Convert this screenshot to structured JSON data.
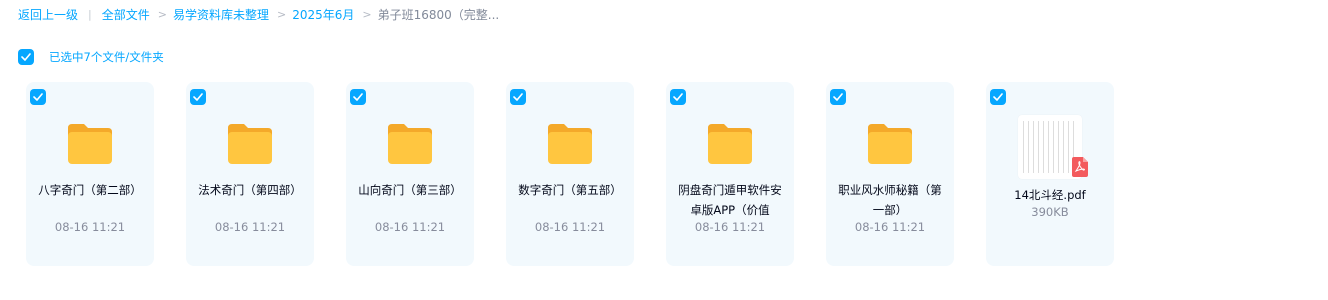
{
  "breadcrumb": {
    "back": "返回上一级",
    "divider": "|",
    "items": [
      "全部文件",
      "易学资料库未整理",
      "2025年6月"
    ],
    "sep": ">",
    "current": "弟子班16800（完整..."
  },
  "selection": {
    "text": "已选中7个文件/文件夹"
  },
  "items": [
    {
      "name": "八字奇门（第二部）",
      "meta": "08-16 11:21",
      "type": "folder"
    },
    {
      "name": "法术奇门（第四部）",
      "meta": "08-16 11:21",
      "type": "folder"
    },
    {
      "name": "山向奇门（第三部）",
      "meta": "08-16 11:21",
      "type": "folder"
    },
    {
      "name": "数字奇门（第五部）",
      "meta": "08-16 11:21",
      "type": "folder"
    },
    {
      "name": "阴盘奇门遁甲软件安卓版APP（价值",
      "meta": "08-16 11:21",
      "type": "folder"
    },
    {
      "name": "职业风水师秘籍（第一部）",
      "meta": "08-16 11:21",
      "type": "folder"
    },
    {
      "name": "14北斗经.pdf",
      "meta": "390KB",
      "type": "pdf"
    }
  ],
  "colors": {
    "accent": "#06a7ff",
    "card_bg": "#f2f9fd",
    "folder": "#ffc640",
    "pdf_badge": "#f35a5d"
  }
}
